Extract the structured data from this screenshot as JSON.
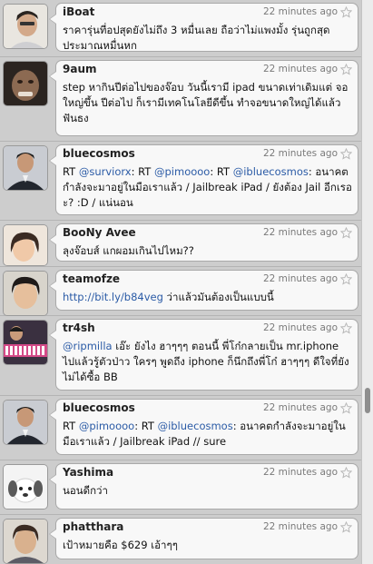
{
  "tweets": [
    {
      "user": "iBoat",
      "time": "22 minutes ago",
      "text": "ราคารุ่นที่อปสุดยังไม่ถึง 3 หมื่นเลย ถือว่าไม่แพงมั้ง รุ่นถูกสุด ประมาณหมื่นหก"
    },
    {
      "user": "9aum",
      "time": "22 minutes ago",
      "text": "step หากินปีต่อไปของจ๊อบ วันนี้เรามี ipad ขนาดเท่าเดิมแต่ จอใหญ่ขึ้น ปีต่อไป ก็เรามีเทคโนโลยีดีขึ้น ทำจอขนาดใหญ่ได้แล้ว ฟันธง"
    },
    {
      "user": "bluecosmos",
      "time": "22 minutes ago",
      "text_pre": "RT ",
      "m1": "@surviorx",
      "mid1": ": RT ",
      "m2": "@pimoooo",
      "mid2": ": RT ",
      "m3": "@ibluecosmos",
      "text_post": ": อนาคตกำลังจะมาอยู่ในมือเราแล้ว / Jailbreak iPad / ยังต้อง Jail อีกเรอะ? :D / แน่นอน"
    },
    {
      "user": "BooNy Avee",
      "time": "22 minutes ago",
      "text": "ลุงจ๊อบส์ แกผอมเกินไปไหม??"
    },
    {
      "user": "teamofze",
      "time": "22 minutes ago",
      "link": "http://bit.ly/b84veg",
      "text_post": " ว่าแล้วมันต้องเป็นแบบนี้"
    },
    {
      "user": "tr4sh",
      "time": "22 minutes ago",
      "m1": "@ripmilla",
      "text_post": " เอ๊ะ ยังไง ฮาๆๆๆ ตอนนี้ พี่โก๋กลายเป็น mr.iphone ไปแล้วรู้ตัวป่าว ใครๆ พูดถึง iphone ก็นึกถึงพี่โก๋ ฮาๆๆๆ ดีใจที่ยังไม่ได้ซื้อ BB"
    },
    {
      "user": "bluecosmos",
      "time": "22 minutes ago",
      "text_pre": "RT ",
      "m1": "@pimoooo",
      "mid1": ": RT ",
      "m2": "@ibluecosmos",
      "text_post": ": อนาคตกำลังจะมาอยู่ในมือเราแล้ว / Jailbreak iPad // sure"
    },
    {
      "user": "Yashima",
      "time": "22 minutes ago",
      "text": "นอนดีกว่า"
    },
    {
      "user": "phatthara",
      "time": "22 minutes ago",
      "text": "เป้าหมายคือ $629 เอ้าๆๆ"
    }
  ],
  "colors": {
    "link": "#2b5ba6",
    "bubble": "#f8f8f8",
    "background": "#cdcdcd"
  },
  "icons": {
    "favorite": "star-icon"
  }
}
